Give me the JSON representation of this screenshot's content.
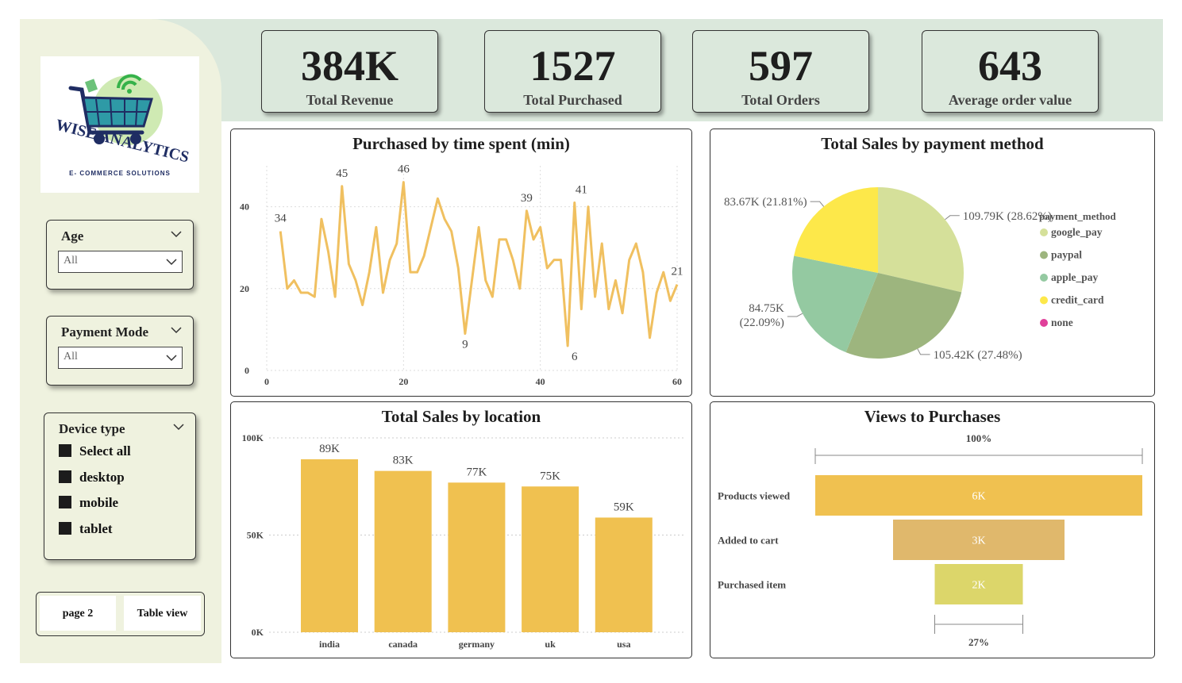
{
  "kpis": [
    {
      "value": "384K",
      "label": "Total Revenue"
    },
    {
      "value": "1527",
      "label": "Total Purchased"
    },
    {
      "value": "597",
      "label": "Total Orders"
    },
    {
      "value": "643",
      "label": "Average order value"
    }
  ],
  "logo": {
    "brand": "WISE ANALYTICS",
    "tagline": "E- COMMERCE SOLUTIONS"
  },
  "filters": {
    "age": {
      "title": "Age",
      "value": "All"
    },
    "payment_mode": {
      "title": "Payment Mode",
      "value": "All"
    },
    "device_type": {
      "title": "Device type",
      "options": [
        "Select all",
        "desktop",
        "mobile",
        "tablet"
      ]
    }
  },
  "nav": {
    "page2": "page 2",
    "table_view": "Table view"
  },
  "panels": {
    "time_spent": "Purchased by time spent (min)",
    "payment": "Total Sales by payment method",
    "location": "Total Sales by location",
    "funnel": "Views to Purchases"
  },
  "colors": {
    "line": "#f0c060",
    "bar": "#f0c150",
    "topband": "#dbe8dc",
    "sidebar": "#eff2df"
  },
  "chart_data": [
    {
      "type": "line",
      "title": "Purchased by time spent (min)",
      "x": [
        2,
        3,
        4,
        5,
        6,
        7,
        8,
        9,
        10,
        11,
        12,
        13,
        14,
        15,
        16,
        17,
        18,
        19,
        20,
        21,
        22,
        23,
        24,
        25,
        26,
        27,
        28,
        29,
        30,
        31,
        32,
        33,
        34,
        35,
        36,
        37,
        38,
        39,
        40,
        41,
        42,
        43,
        44,
        45,
        46,
        47,
        48,
        49,
        50,
        51,
        52,
        53,
        54,
        55,
        56,
        57,
        58,
        59,
        60
      ],
      "y": [
        34,
        20,
        22,
        19,
        19,
        18,
        37,
        29,
        18,
        45,
        26,
        22,
        16,
        24,
        35,
        19,
        27,
        31,
        46,
        24,
        24,
        28,
        35,
        42,
        37,
        34,
        25,
        9,
        22,
        35,
        22,
        18,
        32,
        32,
        27,
        20,
        39,
        32,
        35,
        25,
        27,
        27,
        6,
        41,
        15,
        40,
        18,
        31,
        15,
        22,
        14,
        27,
        31,
        24,
        8,
        19,
        24,
        17,
        21
      ],
      "point_labels": [
        {
          "x": 2,
          "y": 34
        },
        {
          "x": 11,
          "y": 45
        },
        {
          "x": 20,
          "y": 46
        },
        {
          "x": 29,
          "y": 9
        },
        {
          "x": 38,
          "y": 39
        },
        {
          "x": 45,
          "y": 6
        },
        {
          "x": 46,
          "y": 41
        },
        {
          "x": 60,
          "y": 21
        }
      ],
      "xticks": [
        0,
        20,
        40,
        60
      ],
      "yticks": [
        0,
        20,
        40
      ],
      "xlim": [
        0,
        60
      ],
      "ylim": [
        0,
        50
      ]
    },
    {
      "type": "pie",
      "title": "Total Sales by payment method",
      "legend_title": "payment_method",
      "legend_position": "right",
      "slices": [
        {
          "name": "google_pay",
          "value": 109.79,
          "label": "109.79K (28.62%)",
          "color": "#d5e09a"
        },
        {
          "name": "paypal",
          "value": 105.42,
          "label": "105.42K (27.48%)",
          "color": "#9db57e"
        },
        {
          "name": "apple_pay",
          "value": 84.75,
          "label": "84.75K (22.09%)",
          "color": "#94c9a1"
        },
        {
          "name": "credit_card",
          "value": 83.67,
          "label": "83.67K (21.81%)",
          "color": "#fde84a"
        },
        {
          "name": "none",
          "value": 0,
          "label": "",
          "color": "#e0409a"
        }
      ]
    },
    {
      "type": "bar",
      "title": "Total Sales by location",
      "categories": [
        "india",
        "canada",
        "germany",
        "uk",
        "usa"
      ],
      "values": [
        89,
        83,
        77,
        75,
        59
      ],
      "value_labels": [
        "89K",
        "83K",
        "77K",
        "75K",
        "59K"
      ],
      "yticks": [
        "0K",
        "50K",
        "100K"
      ],
      "ylim": [
        0,
        100
      ]
    },
    {
      "type": "funnel",
      "title": "Views to Purchases",
      "stages": [
        {
          "name": "Products viewed",
          "value": 6,
          "label": "6K",
          "color": "#f0c150"
        },
        {
          "name": "Added to cart",
          "value": 3,
          "label": "3K",
          "color": "#e0b86c"
        },
        {
          "name": "Purchased item",
          "value": 2,
          "label": "2K",
          "color": "#dcd66a"
        }
      ],
      "top_percent": "100%",
      "bottom_percent": "27%"
    }
  ]
}
